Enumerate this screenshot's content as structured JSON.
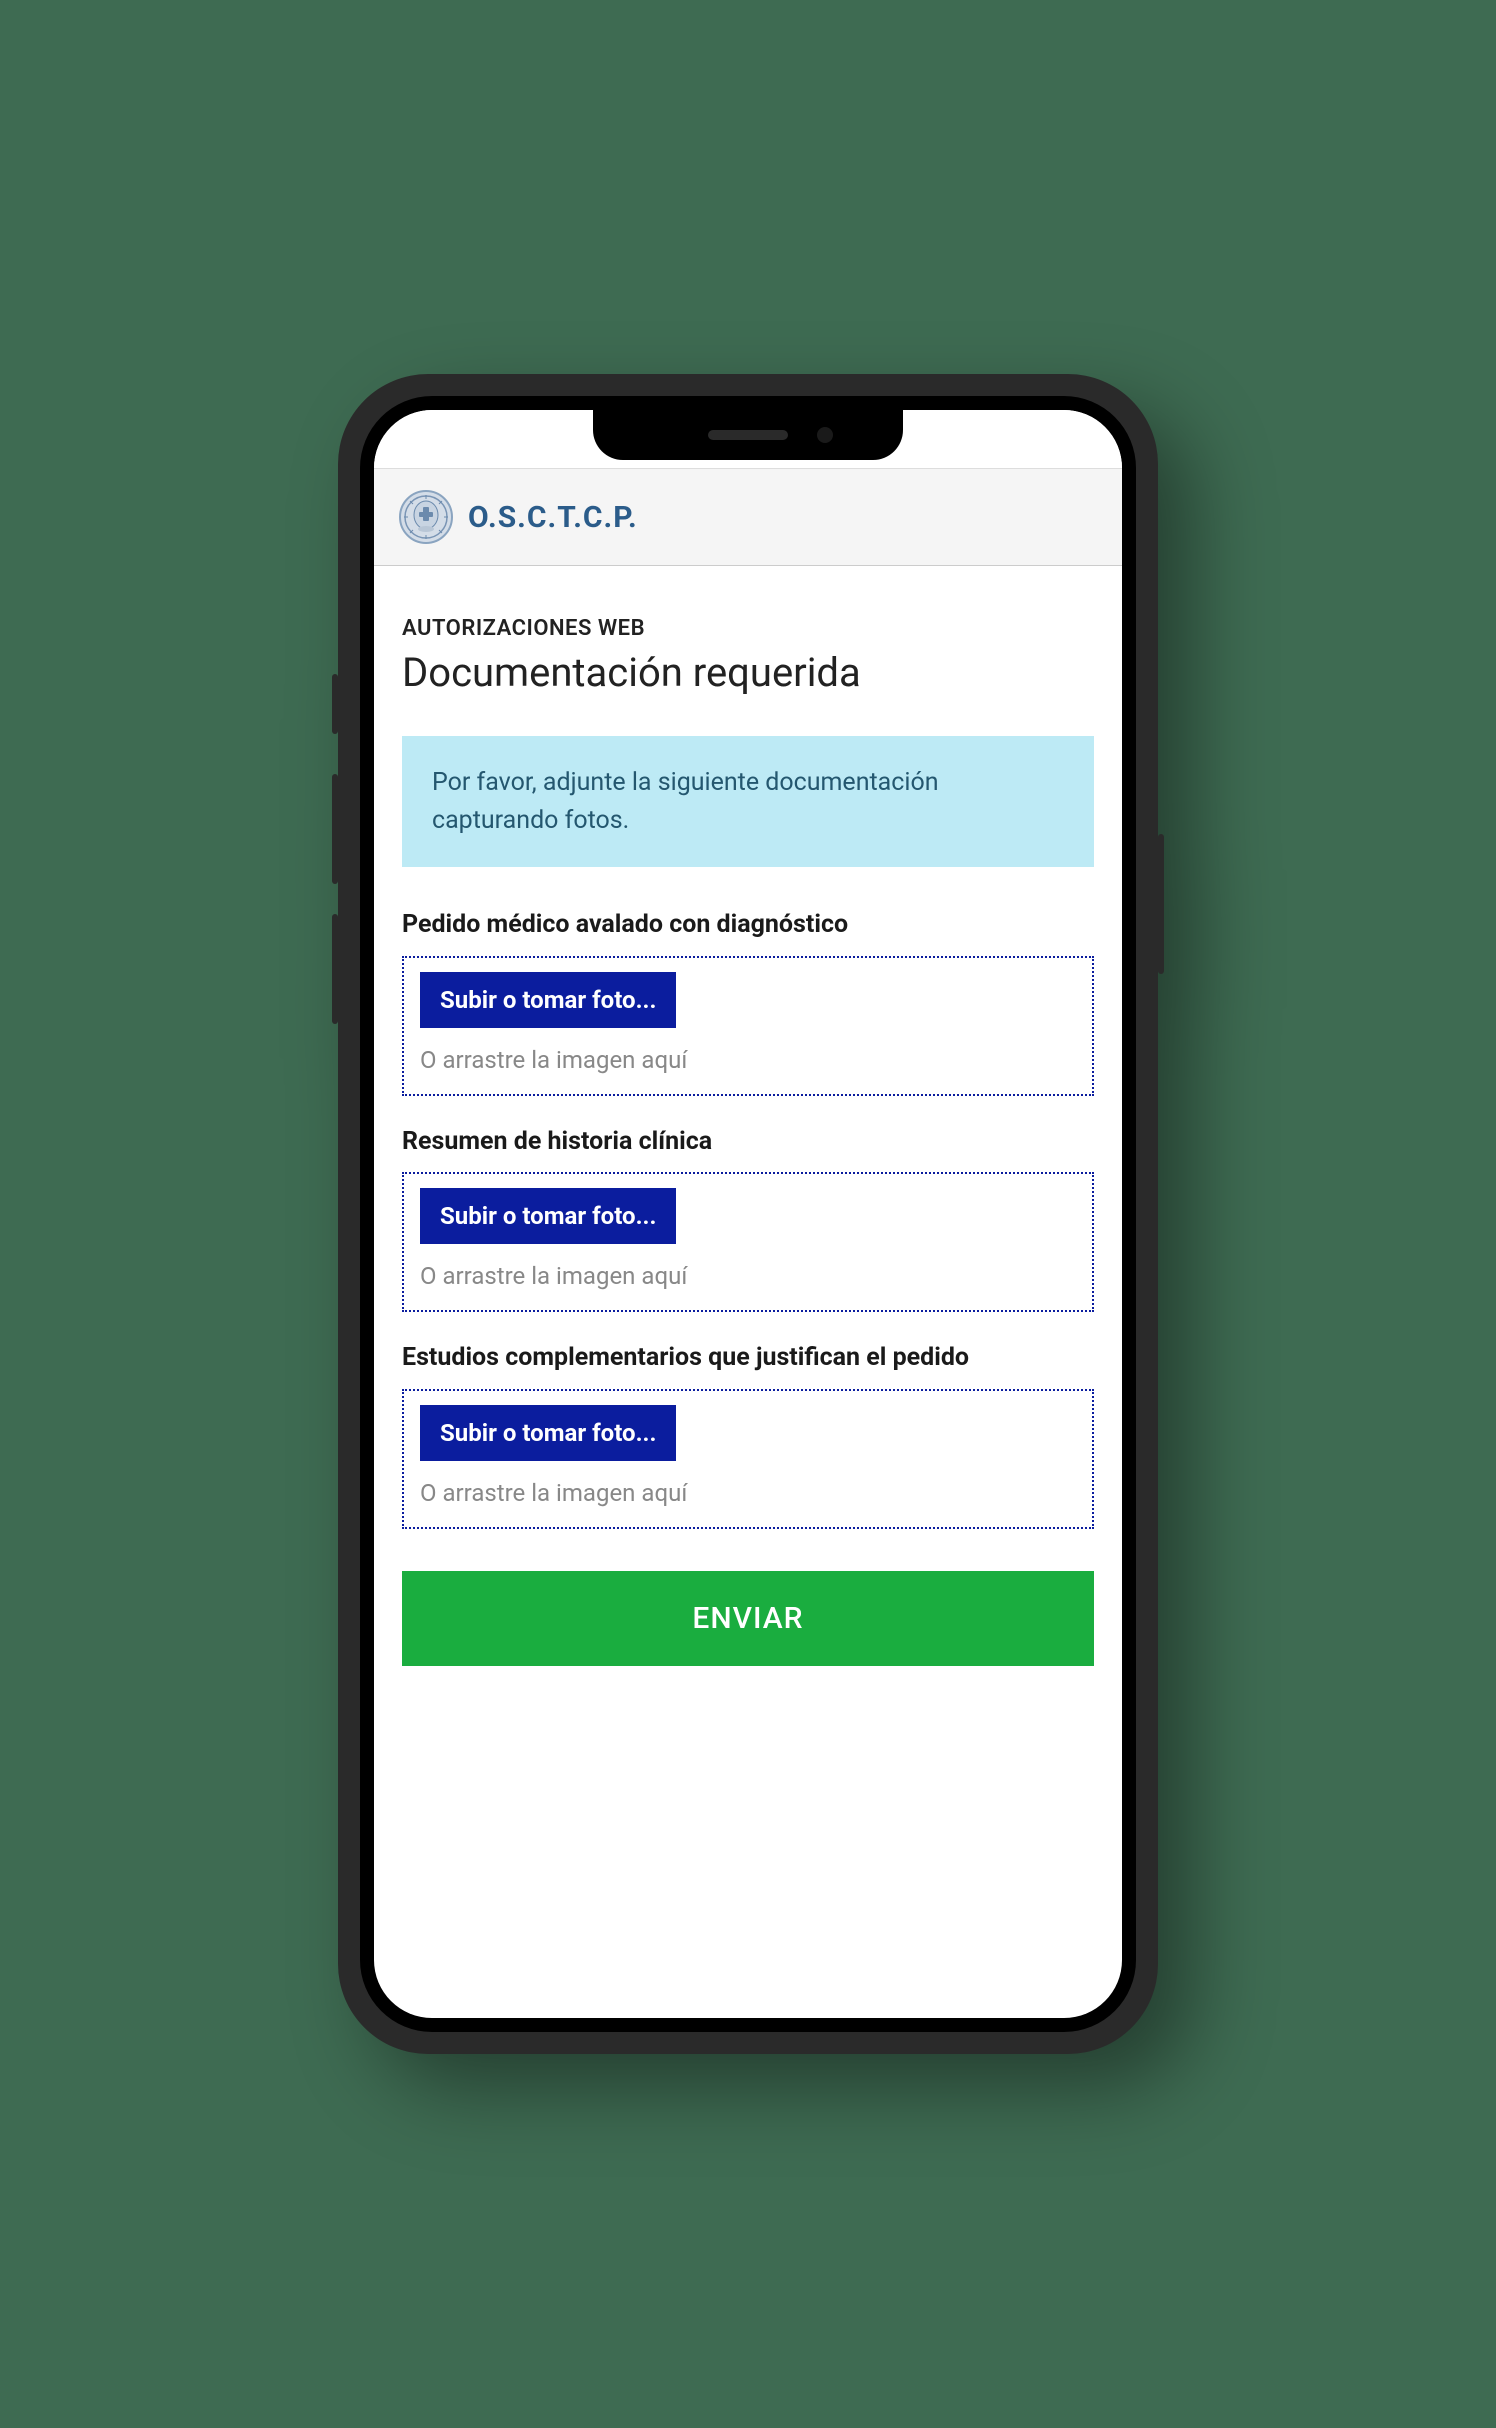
{
  "header": {
    "app_name": "O.S.C.T.C.P."
  },
  "main": {
    "section_label": "AUTORIZACIONES WEB",
    "page_title": "Documentación requerida",
    "info_text": "Por favor, adjunte la siguiente documentación capturando fotos.",
    "uploads": [
      {
        "label": "Pedido médico avalado con diagnóstico",
        "button": "Subir o tomar foto...",
        "hint": "O arrastre la imagen aquí"
      },
      {
        "label": "Resumen de historia clínica",
        "button": "Subir o tomar foto...",
        "hint": "O arrastre la imagen aquí"
      },
      {
        "label": "Estudios complementarios que justifican el pedido",
        "button": "Subir o tomar foto...",
        "hint": "O arrastre la imagen aquí"
      }
    ],
    "submit_label": "ENVIAR"
  }
}
